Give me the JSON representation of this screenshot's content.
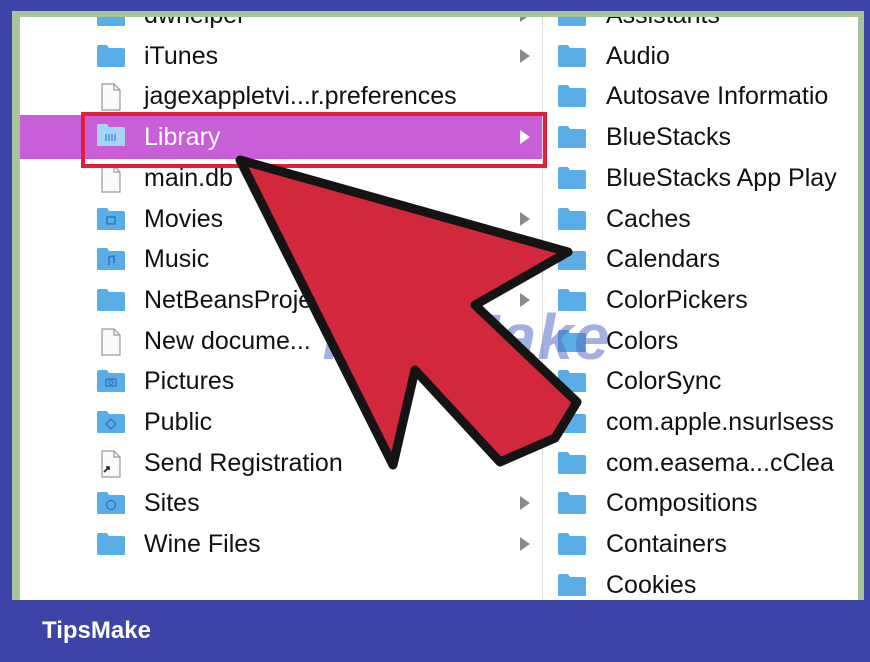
{
  "window": {
    "brand": "TipsMake",
    "watermark": "TipsMake"
  },
  "left_column": {
    "items": [
      {
        "label": "dwhelper",
        "icon": "folder-icon",
        "has_children": true
      },
      {
        "label": "iTunes",
        "icon": "folder-icon",
        "has_children": true
      },
      {
        "label": "jagexappletvi...r.preferences",
        "icon": "document-icon",
        "has_children": false
      },
      {
        "label": "Library",
        "icon": "library-folder-icon",
        "has_children": true,
        "selected": true
      },
      {
        "label": "main.db",
        "icon": "document-icon",
        "has_children": false
      },
      {
        "label": "Movies",
        "icon": "movies-folder-icon",
        "has_children": true
      },
      {
        "label": "Music",
        "icon": "music-folder-icon",
        "has_children": true
      },
      {
        "label": "NetBeansProjects",
        "icon": "folder-icon",
        "has_children": true
      },
      {
        "label": "New docume...",
        "icon": "document-icon",
        "has_children": false
      },
      {
        "label": "Pictures",
        "icon": "pictures-folder-icon",
        "has_children": true
      },
      {
        "label": "Public",
        "icon": "public-folder-icon",
        "has_children": true
      },
      {
        "label": "Send Registration",
        "icon": "alias-document-icon",
        "has_children": false
      },
      {
        "label": "Sites",
        "icon": "sites-folder-icon",
        "has_children": true
      },
      {
        "label": "Wine Files",
        "icon": "folder-icon",
        "has_children": true
      }
    ]
  },
  "right_column": {
    "items": [
      {
        "label": "Assistants",
        "icon": "folder-icon"
      },
      {
        "label": "Audio",
        "icon": "folder-icon"
      },
      {
        "label": "Autosave Informatio",
        "icon": "folder-icon"
      },
      {
        "label": "BlueStacks",
        "icon": "folder-icon"
      },
      {
        "label": "BlueStacks App Play",
        "icon": "folder-icon"
      },
      {
        "label": "Caches",
        "icon": "folder-icon"
      },
      {
        "label": "Calendars",
        "icon": "folder-icon"
      },
      {
        "label": "ColorPickers",
        "icon": "folder-icon"
      },
      {
        "label": "Colors",
        "icon": "folder-icon"
      },
      {
        "label": "ColorSync",
        "icon": "folder-icon"
      },
      {
        "label": "com.apple.nsurlsess",
        "icon": "folder-icon"
      },
      {
        "label": "com.easema...cClea",
        "icon": "folder-icon"
      },
      {
        "label": "Compositions",
        "icon": "folder-icon"
      },
      {
        "label": "Containers",
        "icon": "folder-icon"
      },
      {
        "label": "Cookies",
        "icon": "folder-icon"
      }
    ]
  },
  "colors": {
    "selection": "#c95fd8",
    "outline": "#e0203a",
    "arrow": "#d3283c",
    "frame": "#3c44a8",
    "folder": "#5aaee6"
  }
}
